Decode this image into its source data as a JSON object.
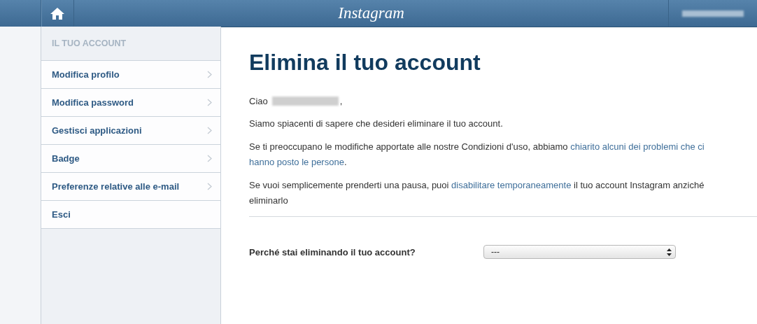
{
  "header": {
    "logo": "Instagram"
  },
  "sidebar": {
    "heading": "IL TUO ACCOUNT",
    "items": [
      {
        "label": "Modifica profilo",
        "chevron": true
      },
      {
        "label": "Modifica password",
        "chevron": true
      },
      {
        "label": "Gestisci applicazioni",
        "chevron": true
      },
      {
        "label": "Badge",
        "chevron": true
      },
      {
        "label": "Preferenze relative alle e-mail",
        "chevron": true
      },
      {
        "label": "Esci",
        "chevron": false
      }
    ]
  },
  "content": {
    "title": "Elimina il tuo account",
    "greeting": {
      "prefix": "Ciao",
      "suffix": ","
    },
    "paragraphs": [
      {
        "parts": [
          {
            "kind": "text",
            "text": "Siamo spiacenti di sapere che desideri eliminare il tuo account."
          }
        ]
      },
      {
        "parts": [
          {
            "kind": "text",
            "text": "Se ti preoccupano le modifiche apportate alle nostre Condizioni d'uso, abbiamo"
          },
          {
            "kind": "link",
            "text": "chiarito alcuni dei problemi che ci"
          },
          {
            "kind": "link",
            "text": "hanno posto le persone"
          },
          {
            "kind": "text",
            "text": "."
          }
        ]
      },
      {
        "parts": [
          {
            "kind": "text",
            "text": "Se vuoi semplicemente prenderti una pausa, puoi"
          },
          {
            "kind": "link",
            "text": "disabilitare temporaneamente"
          },
          {
            "kind": "text",
            "text": "il tuo account Instagram anziché eliminarlo"
          }
        ]
      }
    ],
    "question": {
      "label": "Perché stai eliminando il tuo account?",
      "value": "---"
    }
  }
}
